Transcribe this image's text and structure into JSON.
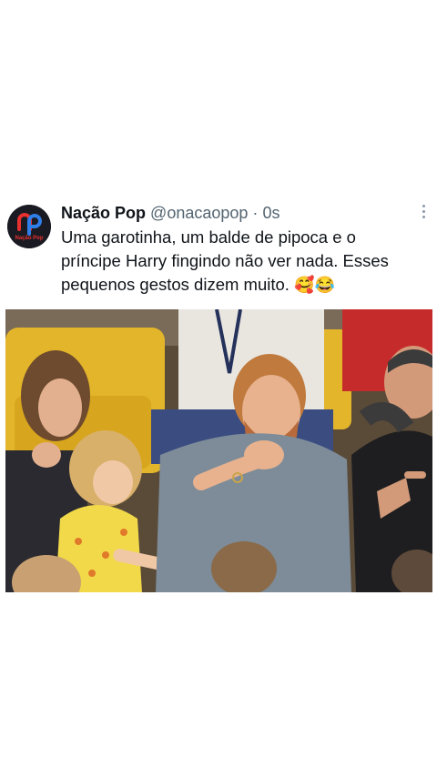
{
  "tweet": {
    "author_name": "Nação Pop",
    "handle": "@onacaopop",
    "separator": "·",
    "time": "0s",
    "text_line1": "Uma garotinha, um balde de pipoca e o",
    "text_line2": "príncipe Harry fingindo não ver nada. Esses",
    "text_line3": "pequenos gestos dizem muito.",
    "emojis": "🥰😂",
    "avatar_logo_text": "Nação Pop"
  },
  "colors": {
    "name": "#0f1419",
    "secondary": "#536471",
    "avatar_bg": "#1a1a22",
    "logo_red": "#e8302f",
    "logo_blue": "#2f7fe8"
  },
  "icons": [
    "more-options-icon",
    "avatar-logo"
  ]
}
